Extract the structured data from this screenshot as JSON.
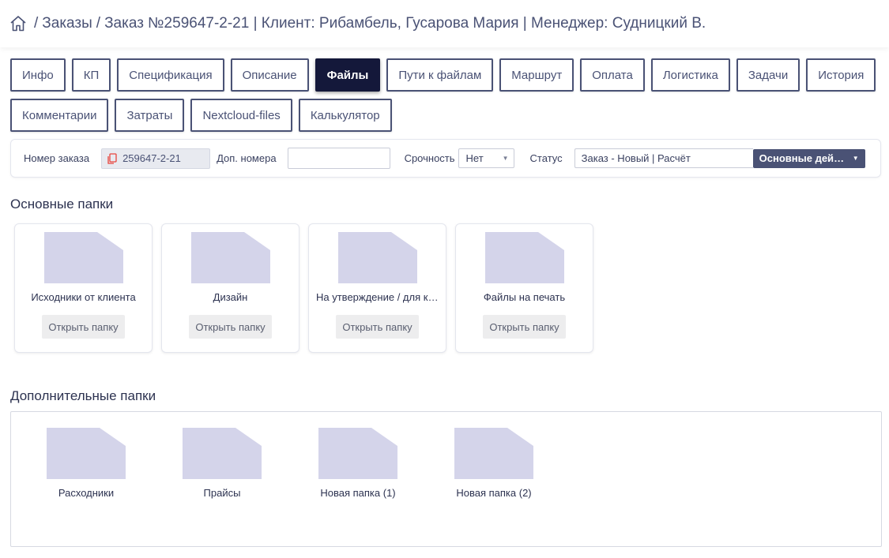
{
  "breadcrumb": {
    "orders": "Заказы",
    "order": "Заказ №259647-2-21 | Клиент: Рибамбель, Гусарова Мария | Менеджер: Судницкий В.",
    "separator": "/"
  },
  "tabs": {
    "row1": [
      "Инфо",
      "КП",
      "Спецификация",
      "Описание",
      "Файлы",
      "Пути к файлам",
      "Маршрут",
      "Оплата",
      "Логистика",
      "Задачи",
      "История"
    ],
    "row2": [
      "Комментарии",
      "Затраты",
      "Nextcloud-files",
      "Калькулятор"
    ],
    "active": "Файлы"
  },
  "infobar": {
    "order_label": "Номер заказа",
    "order_value": "259647-2-21",
    "extra_label": "Доп. номера",
    "extra_value": "",
    "urgency_label": "Срочность",
    "urgency_value": "Нет",
    "status_label": "Статус",
    "status_value": "Заказ - Новый | Расчёт",
    "actions_label": "Основные действия"
  },
  "main_section": {
    "title": "Основные папки",
    "open_label": "Открыть папку",
    "folders": [
      "Исходники от клиента",
      "Дизайн",
      "На утверждение / для клиента",
      "Файлы на печать"
    ]
  },
  "extra_section": {
    "title": "Дополнительные папки",
    "folders": [
      "Расходники",
      "Прайсы",
      "Новая папка (1)",
      "Новая папка (2)"
    ]
  },
  "colors": {
    "accent": "#4a5275",
    "active_tab": "#14183a",
    "folder": "#d4d4ea",
    "copy_icon": "#e8453c"
  },
  "icons": {
    "home": "home-icon",
    "copy": "copy-icon",
    "folder": "folder-icon",
    "caret": "caret-down-icon"
  }
}
